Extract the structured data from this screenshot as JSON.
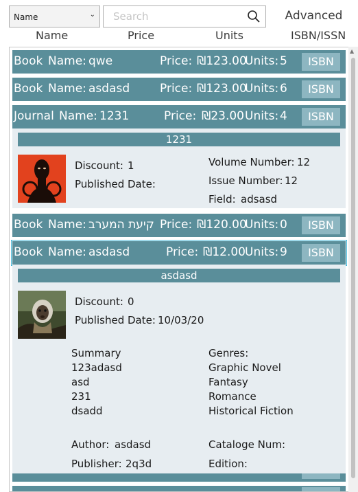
{
  "toolbar": {
    "sort_value": "Name",
    "search_placeholder": "Search",
    "advanced_label": "Advanced"
  },
  "columns": [
    "Name",
    "Price",
    "Units",
    "ISBN/ISSN"
  ],
  "labels": {
    "name": "Name:",
    "price": "Price:",
    "units": "Units:",
    "isbn": "ISBN",
    "discount": "Discount:",
    "published_date": "Published Date:",
    "volume_number": "Volume Number:",
    "issue_number": "Issue Number:",
    "field": "Field:",
    "summary": "Summary",
    "genres": "Genres:",
    "author": "Author:",
    "cataloge_num": "Cataloge Num:",
    "publisher": "Publisher:",
    "edition": "Edition:"
  },
  "rows": [
    {
      "type": "Book",
      "name": "qwe",
      "price": "₪123.00",
      "units": "5"
    },
    {
      "type": "Book",
      "name": "asdasd",
      "price": "₪123.00",
      "units": "6"
    },
    {
      "type": "Journal",
      "name": "1231",
      "price": "₪23.00",
      "units": "4"
    },
    {
      "type": "Book",
      "name": "קיעת המערב",
      "price": "₪120.00",
      "units": "0"
    },
    {
      "type": "Book",
      "name": "asdasd",
      "price": "₪12.00",
      "units": "9"
    }
  ],
  "journal_detail": {
    "title": "1231",
    "discount": "1",
    "published_date": "",
    "volume_number": "12",
    "issue_number": "12",
    "field": "adsasd"
  },
  "book_detail": {
    "title": "asdasd",
    "discount": "0",
    "published_date": "10/03/20",
    "summary_lines": [
      "123adasd",
      "asd",
      "231",
      "dsadd"
    ],
    "genres": [
      "Graphic Novel",
      "Fantasy",
      "Romance",
      "Historical Fiction"
    ],
    "author": "asdasd",
    "cataloge_num": "",
    "publisher": "2q3d",
    "edition": ""
  },
  "colors": {
    "row_bg": "#5a8e9a",
    "isbn_button_bg": "#8db6c1",
    "detail_bg": "#e7edf1",
    "selection_outline": "#3fb4d6"
  }
}
